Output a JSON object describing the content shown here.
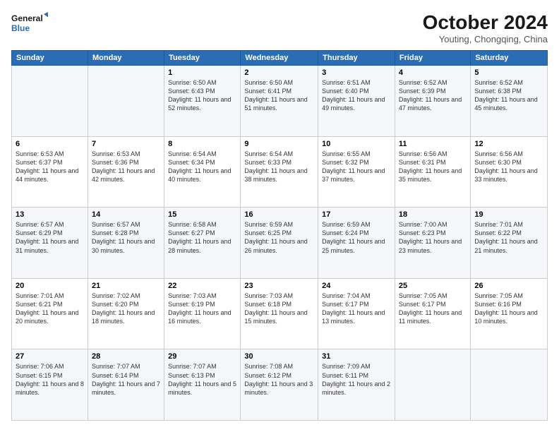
{
  "logo": {
    "line1": "General",
    "line2": "Blue"
  },
  "title": "October 2024",
  "subtitle": "Youting, Chongqing, China",
  "header_days": [
    "Sunday",
    "Monday",
    "Tuesday",
    "Wednesday",
    "Thursday",
    "Friday",
    "Saturday"
  ],
  "weeks": [
    [
      {
        "day": "",
        "info": ""
      },
      {
        "day": "",
        "info": ""
      },
      {
        "day": "1",
        "info": "Sunrise: 6:50 AM\nSunset: 6:43 PM\nDaylight: 11 hours and 52 minutes."
      },
      {
        "day": "2",
        "info": "Sunrise: 6:50 AM\nSunset: 6:41 PM\nDaylight: 11 hours and 51 minutes."
      },
      {
        "day": "3",
        "info": "Sunrise: 6:51 AM\nSunset: 6:40 PM\nDaylight: 11 hours and 49 minutes."
      },
      {
        "day": "4",
        "info": "Sunrise: 6:52 AM\nSunset: 6:39 PM\nDaylight: 11 hours and 47 minutes."
      },
      {
        "day": "5",
        "info": "Sunrise: 6:52 AM\nSunset: 6:38 PM\nDaylight: 11 hours and 45 minutes."
      }
    ],
    [
      {
        "day": "6",
        "info": "Sunrise: 6:53 AM\nSunset: 6:37 PM\nDaylight: 11 hours and 44 minutes."
      },
      {
        "day": "7",
        "info": "Sunrise: 6:53 AM\nSunset: 6:36 PM\nDaylight: 11 hours and 42 minutes."
      },
      {
        "day": "8",
        "info": "Sunrise: 6:54 AM\nSunset: 6:34 PM\nDaylight: 11 hours and 40 minutes."
      },
      {
        "day": "9",
        "info": "Sunrise: 6:54 AM\nSunset: 6:33 PM\nDaylight: 11 hours and 38 minutes."
      },
      {
        "day": "10",
        "info": "Sunrise: 6:55 AM\nSunset: 6:32 PM\nDaylight: 11 hours and 37 minutes."
      },
      {
        "day": "11",
        "info": "Sunrise: 6:56 AM\nSunset: 6:31 PM\nDaylight: 11 hours and 35 minutes."
      },
      {
        "day": "12",
        "info": "Sunrise: 6:56 AM\nSunset: 6:30 PM\nDaylight: 11 hours and 33 minutes."
      }
    ],
    [
      {
        "day": "13",
        "info": "Sunrise: 6:57 AM\nSunset: 6:29 PM\nDaylight: 11 hours and 31 minutes."
      },
      {
        "day": "14",
        "info": "Sunrise: 6:57 AM\nSunset: 6:28 PM\nDaylight: 11 hours and 30 minutes."
      },
      {
        "day": "15",
        "info": "Sunrise: 6:58 AM\nSunset: 6:27 PM\nDaylight: 11 hours and 28 minutes."
      },
      {
        "day": "16",
        "info": "Sunrise: 6:59 AM\nSunset: 6:25 PM\nDaylight: 11 hours and 26 minutes."
      },
      {
        "day": "17",
        "info": "Sunrise: 6:59 AM\nSunset: 6:24 PM\nDaylight: 11 hours and 25 minutes."
      },
      {
        "day": "18",
        "info": "Sunrise: 7:00 AM\nSunset: 6:23 PM\nDaylight: 11 hours and 23 minutes."
      },
      {
        "day": "19",
        "info": "Sunrise: 7:01 AM\nSunset: 6:22 PM\nDaylight: 11 hours and 21 minutes."
      }
    ],
    [
      {
        "day": "20",
        "info": "Sunrise: 7:01 AM\nSunset: 6:21 PM\nDaylight: 11 hours and 20 minutes."
      },
      {
        "day": "21",
        "info": "Sunrise: 7:02 AM\nSunset: 6:20 PM\nDaylight: 11 hours and 18 minutes."
      },
      {
        "day": "22",
        "info": "Sunrise: 7:03 AM\nSunset: 6:19 PM\nDaylight: 11 hours and 16 minutes."
      },
      {
        "day": "23",
        "info": "Sunrise: 7:03 AM\nSunset: 6:18 PM\nDaylight: 11 hours and 15 minutes."
      },
      {
        "day": "24",
        "info": "Sunrise: 7:04 AM\nSunset: 6:17 PM\nDaylight: 11 hours and 13 minutes."
      },
      {
        "day": "25",
        "info": "Sunrise: 7:05 AM\nSunset: 6:17 PM\nDaylight: 11 hours and 11 minutes."
      },
      {
        "day": "26",
        "info": "Sunrise: 7:05 AM\nSunset: 6:16 PM\nDaylight: 11 hours and 10 minutes."
      }
    ],
    [
      {
        "day": "27",
        "info": "Sunrise: 7:06 AM\nSunset: 6:15 PM\nDaylight: 11 hours and 8 minutes."
      },
      {
        "day": "28",
        "info": "Sunrise: 7:07 AM\nSunset: 6:14 PM\nDaylight: 11 hours and 7 minutes."
      },
      {
        "day": "29",
        "info": "Sunrise: 7:07 AM\nSunset: 6:13 PM\nDaylight: 11 hours and 5 minutes."
      },
      {
        "day": "30",
        "info": "Sunrise: 7:08 AM\nSunset: 6:12 PM\nDaylight: 11 hours and 3 minutes."
      },
      {
        "day": "31",
        "info": "Sunrise: 7:09 AM\nSunset: 6:11 PM\nDaylight: 11 hours and 2 minutes."
      },
      {
        "day": "",
        "info": ""
      },
      {
        "day": "",
        "info": ""
      }
    ]
  ]
}
